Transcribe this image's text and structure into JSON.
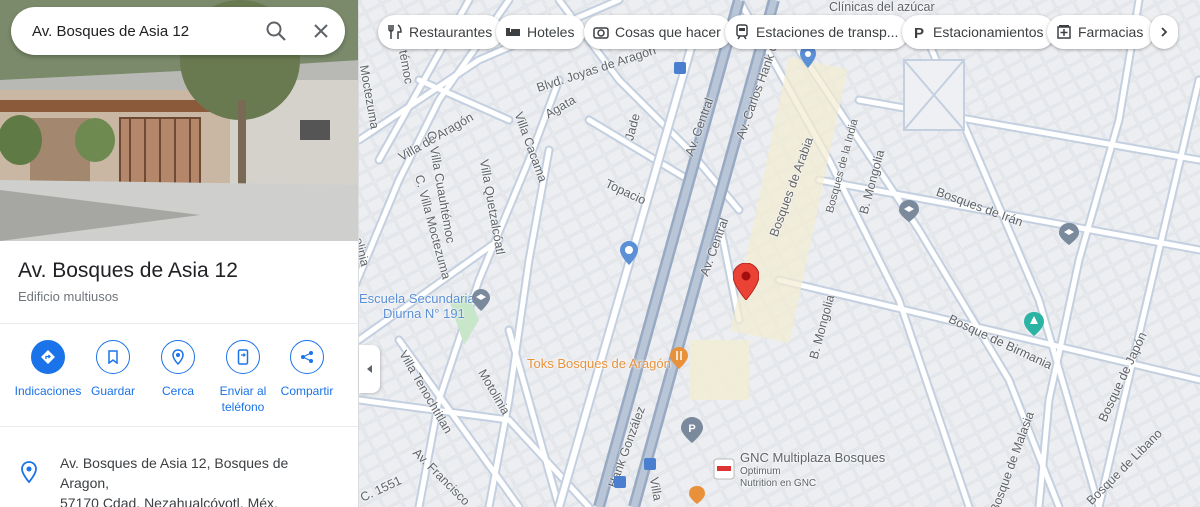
{
  "search": {
    "value": "Av. Bosques de Asia 12"
  },
  "place": {
    "title": "Av. Bosques de Asia 12",
    "category": "Edificio multiusos",
    "address_line1": "Av. Bosques de Asia 12, Bosques de Aragon,",
    "address_line2": "57170 Cdad. Nezahualcóyotl, Méx."
  },
  "actions": [
    {
      "label": "Indicaciones",
      "icon": "directions-icon"
    },
    {
      "label": "Guardar",
      "icon": "bookmark-icon"
    },
    {
      "label": "Cerca",
      "icon": "nearby-icon"
    },
    {
      "label_line1": "Enviar al",
      "label_line2": "teléfono",
      "icon": "phone-icon"
    },
    {
      "label": "Compartir",
      "icon": "share-icon"
    }
  ],
  "chips": [
    {
      "label": "Restaurantes",
      "icon": "fork-knife-icon"
    },
    {
      "label": "Hoteles",
      "icon": "bed-icon"
    },
    {
      "label": "Cosas que hacer",
      "icon": "camera-icon"
    },
    {
      "label": "Estaciones de transp...",
      "icon": "transit-icon"
    },
    {
      "label": "Estacionamientos",
      "icon": "parking-icon"
    },
    {
      "label": "Farmacias",
      "icon": "pharmacy-icon"
    }
  ],
  "map_labels": {
    "clinicas": "Clínicas del azúcar",
    "blvd_joyas": "Blvd. Joyas de Aragón",
    "moctezuma": "Moctezuma",
    "temoc": "témoc",
    "villa_aragon": "Villa de Aragón",
    "agata": "Agata",
    "jade": "Jade",
    "av_central": "Av. Central",
    "av_carlos_hank": "Av. Carlos Hank Go",
    "villa_cacama": "Villa Cacama",
    "c_villa_cuauhtemoc": "C. Villa Cuauhtémoc",
    "c_villa_moctezuma": "C. Villa Moctezuma",
    "villa_quetzalcoatl": "Villa Quetzalcóatl",
    "topacio": "Topacio",
    "bosques_arabia": "Bosques de Arabia",
    "bosques_india": "Bosques de la India",
    "b_mongolia_top": "B. Mongolia",
    "bosques_iran": "Bosques de Irán",
    "av_central_2": "Av. Central",
    "olinia": "olinia",
    "escuela_1": "Escuela Secundaria",
    "escuela_2": "Diurna N° 191",
    "b_mongolia_mid": "B. Mongolia",
    "bosque_birmania": "Bosque de Birmania",
    "bosque_japon": "Bosque de Japón",
    "villa_tenochtitlan": "Villa Tenochtitlan",
    "motolinia": "Motolinia",
    "toks": "Toks Bosques de Aragón",
    "av_francisco": "Av. Francisco",
    "hank_gonzalez": "Hank González",
    "gnc": "GNC Multiplaza Bosques",
    "optimum_1": "Optimum",
    "optimum_2": "Nutrition en GNC",
    "bosque_malasia": "Bosque de Malasia",
    "bosque_libano": "Bosque de Libano",
    "c1551": "C. 1551",
    "villa_short": "Villa",
    "gnc_logo": "GNC"
  },
  "colors": {
    "accent": "#1a73e8",
    "pin": "#ea4335",
    "main_road": "#8fa3bf",
    "orange_poi": "#e8913a"
  }
}
